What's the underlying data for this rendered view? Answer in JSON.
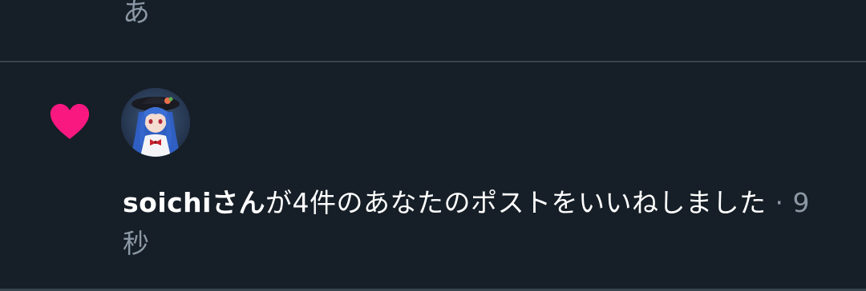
{
  "previous_item": {
    "text": "あ"
  },
  "notification": {
    "icon": "heart-icon",
    "icon_color": "#f91880",
    "avatar": "user-avatar",
    "username": "soichiさん",
    "action_text": "が4件のあなたのポストをいいねしました",
    "separator": " · ",
    "timestamp": "9秒"
  },
  "colors": {
    "background": "#161e27",
    "divider": "#38444d",
    "secondary_text": "#8b98a5",
    "primary_text": "#ffffff"
  }
}
